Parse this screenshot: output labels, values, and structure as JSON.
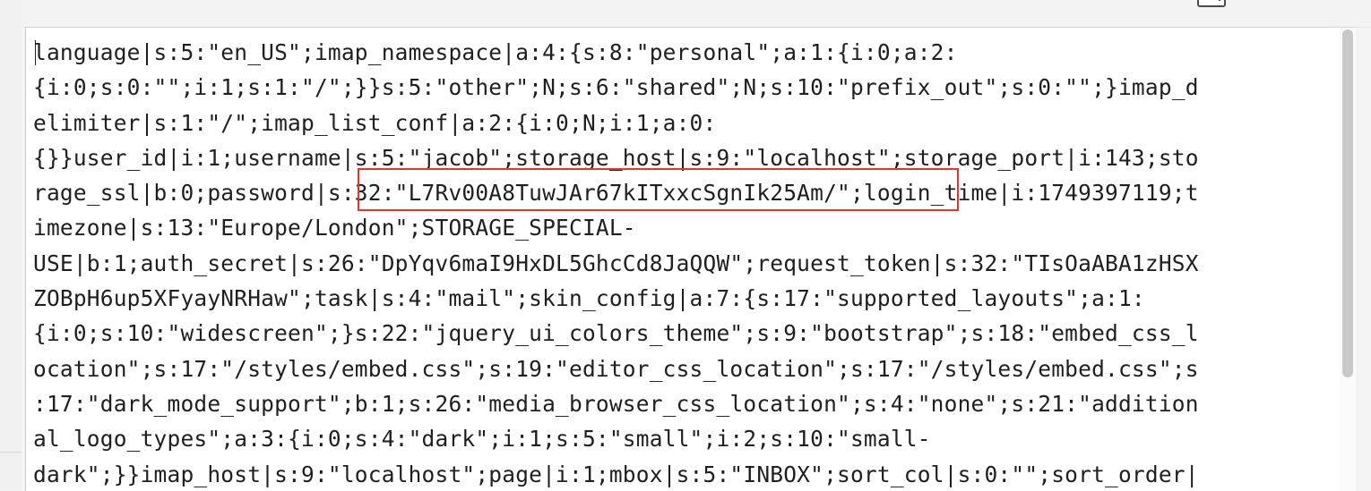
{
  "editor": {
    "lines": [
      "language|s:5:\"en_US\";imap_namespace|a:4:{s:8:\"personal\";a:1:{i:0;a:2:",
      "{i:0;s:0:\"\";i:1;s:1:\"/\";}}s:5:\"other\";N;s:6:\"shared\";N;s:10:\"prefix_out\";s:0:\"\";}imap_d",
      "elimiter|s:1:\"/\";imap_list_conf|a:2:{i:0;N;i:1;a:0:",
      "{}}user_id|i:1;username|s:5:\"jacob\";storage_host|s:9:\"localhost\";storage_port|i:143;sto",
      "rage_ssl|b:0;password|s:32:\"L7Rv00A8TuwJAr67kITxxcSgnIk25Am/\";login_time|i:1749397119;t",
      "imezone|s:13:\"Europe/London\";STORAGE_SPECIAL-",
      "USE|b:1;auth_secret|s:26:\"DpYqv6maI9HxDL5GhcCd8JaQQW\";request_token|s:32:\"TIsOaABA1zHSX",
      "ZOBpH6up5XFyayNRHaw\";task|s:4:\"mail\";skin_config|a:7:{s:17:\"supported_layouts\";a:1:",
      "{i:0;s:10:\"widescreen\";}s:22:\"jquery_ui_colors_theme\";s:9:\"bootstrap\";s:18:\"embed_css_l",
      "ocation\";s:17:\"/styles/embed.css\";s:19:\"editor_css_location\";s:17:\"/styles/embed.css\";s",
      ":17:\"dark_mode_support\";b:1;s:26:\"media_browser_css_location\";s:4:\"none\";s:21:\"addition",
      "al_logo_types\";a:3:{i:0;s:4:\"dark\";i:1;s:5:\"small\";i:2;s:10:\"small-",
      "dark\";}}imap_host|s:9:\"localhost\";page|i:1;mbox|s:5:\"INBOX\";sort_col|s:0:\"\";sort_order|"
    ],
    "highlighted_value": "s:32:\"L7Rv00A8TuwJAr67kITxxcSgnIk25Am/\"",
    "highlight_color": "#e8322c"
  },
  "icons": {
    "top_right": "window-toggle-icon"
  }
}
